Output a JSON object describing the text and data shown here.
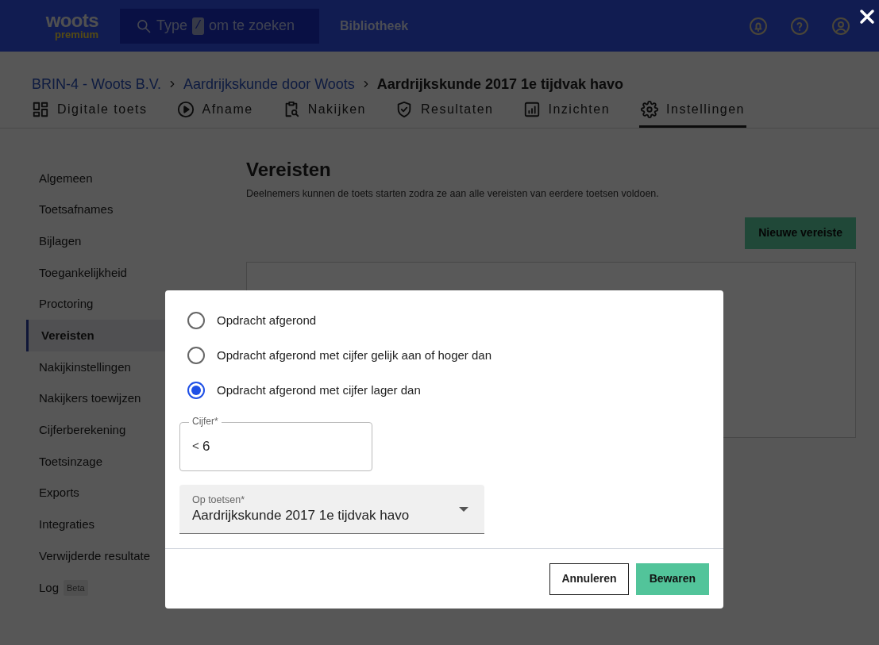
{
  "header": {
    "logo": {
      "name": "woots",
      "tier": "premium"
    },
    "search": {
      "placeholder_before": "Type",
      "key": "/",
      "placeholder_after": "om te zoeken"
    },
    "nav_link": "Bibliotheek"
  },
  "breadcrumbs": [
    {
      "label": "BRIN-4 - Woots B.V.",
      "current": false
    },
    {
      "label": "Aardrijkskunde door Woots",
      "current": false
    },
    {
      "label": "Aardrijkskunde 2017 1e tijdvak havo",
      "current": true
    }
  ],
  "tabs": [
    {
      "label": "Digitale toets",
      "selected": false
    },
    {
      "label": "Afname",
      "selected": false
    },
    {
      "label": "Nakijken",
      "selected": false
    },
    {
      "label": "Resultaten",
      "selected": false
    },
    {
      "label": "Inzichten",
      "selected": false
    },
    {
      "label": "Instellingen",
      "selected": true
    }
  ],
  "sidebar": {
    "items": [
      {
        "label": "Algemeen",
        "selected": false
      },
      {
        "label": "Toetsafnames",
        "selected": false
      },
      {
        "label": "Bijlagen",
        "selected": false
      },
      {
        "label": "Toegankelijkheid",
        "selected": false
      },
      {
        "label": "Proctoring",
        "selected": false
      },
      {
        "label": "Vereisten",
        "selected": true
      },
      {
        "label": "Nakijkinstellingen",
        "selected": false
      },
      {
        "label": "Nakijkers toewijzen",
        "selected": false
      },
      {
        "label": "Cijferberekening",
        "selected": false
      },
      {
        "label": "Toetsinzage",
        "selected": false
      },
      {
        "label": "Exports",
        "selected": false
      },
      {
        "label": "Integraties",
        "selected": false
      },
      {
        "label": "Verwijderde resultate",
        "selected": false
      },
      {
        "label": "Log",
        "selected": false,
        "badge": "Beta"
      }
    ]
  },
  "content": {
    "title": "Vereisten",
    "description": "Deelnemers kunnen de toets starten zodra ze aan alle vereisten van eerdere toetsen voldoen.",
    "new_button": "Nieuwe vereiste"
  },
  "dialog": {
    "options": [
      {
        "label": "Opdracht afgerond",
        "selected": false
      },
      {
        "label": "Opdracht afgerond met cijfer gelijk aan of hoger dan",
        "selected": false
      },
      {
        "label": "Opdracht afgerond met cijfer lager dan",
        "selected": true
      }
    ],
    "grade_field": {
      "label": "Cijfer*",
      "prefix": "<",
      "value": "6"
    },
    "tests_select": {
      "label": "Op toetsen*",
      "value": "Aardrijkskunde 2017 1e tijdvak havo"
    },
    "buttons": {
      "cancel": "Annuleren",
      "save": "Bewaren"
    }
  }
}
